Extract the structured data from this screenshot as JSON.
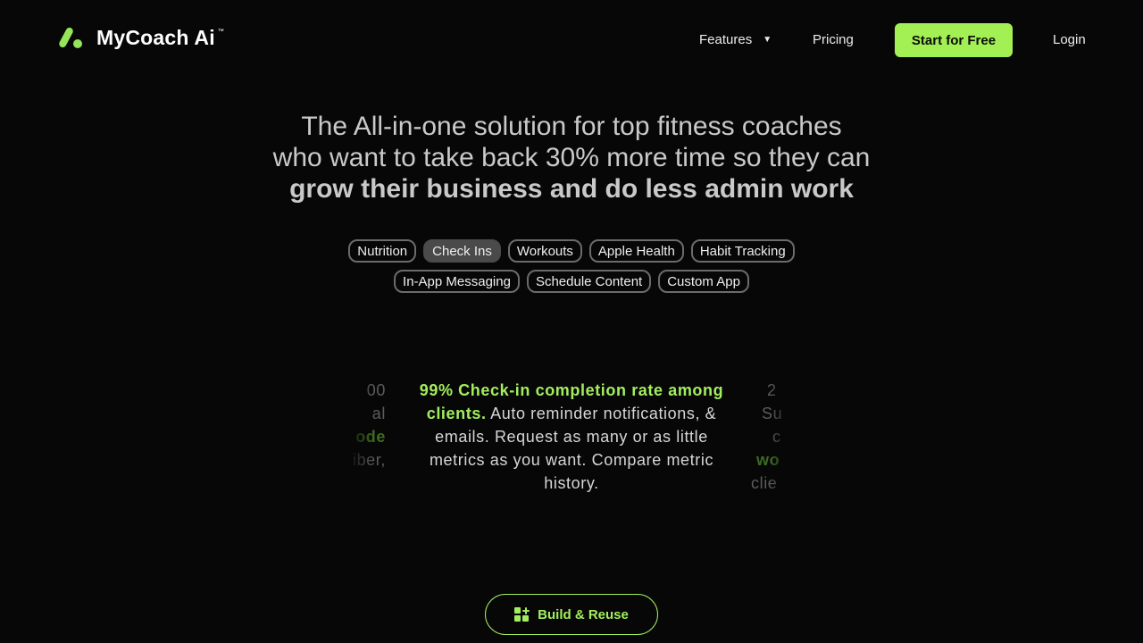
{
  "nav": {
    "logo_text": "MyCoach Ai",
    "logo_tm": "™",
    "features_label": "Features",
    "features_caret": "▼",
    "pricing_label": "Pricing",
    "cta_label": "Start for Free",
    "login_label": "Login"
  },
  "hero": {
    "line1": "The All-in-one solution for top fitness coaches",
    "line2": "who want to take back 30% more time so they can",
    "line3_strong": "grow their business and do less admin work"
  },
  "chips": {
    "row1": [
      {
        "label": "Nutrition",
        "active": false
      },
      {
        "label": "Check Ins",
        "active": true
      },
      {
        "label": "Workouts",
        "active": false
      },
      {
        "label": "Apple Health",
        "active": false
      },
      {
        "label": "Habit Tracking",
        "active": false
      }
    ],
    "row2": [
      {
        "label": "In-App Messaging",
        "active": false
      },
      {
        "label": "Schedule Content",
        "active": false
      },
      {
        "label": "Custom App",
        "active": false
      }
    ]
  },
  "carousel": {
    "center": {
      "highlight": "99% Check-in completion rate among clients.",
      "body": "Auto reminder notifications, & emails. Request as many or as little metrics as you want. Compare metric history."
    },
    "left_ghost": {
      "line1": "00",
      "line2": "al",
      "line3_highlight": "ode",
      "line4": "iber,"
    },
    "right_ghost": {
      "line1": "2",
      "line2": "Su",
      "line3": "c",
      "line4_highlight": "wo",
      "line5": "clie"
    }
  },
  "build_button": {
    "label": "Build & Reuse",
    "icon": "grid-plus-icon"
  },
  "colors": {
    "accent": "#a3f055",
    "background": "#070707"
  }
}
